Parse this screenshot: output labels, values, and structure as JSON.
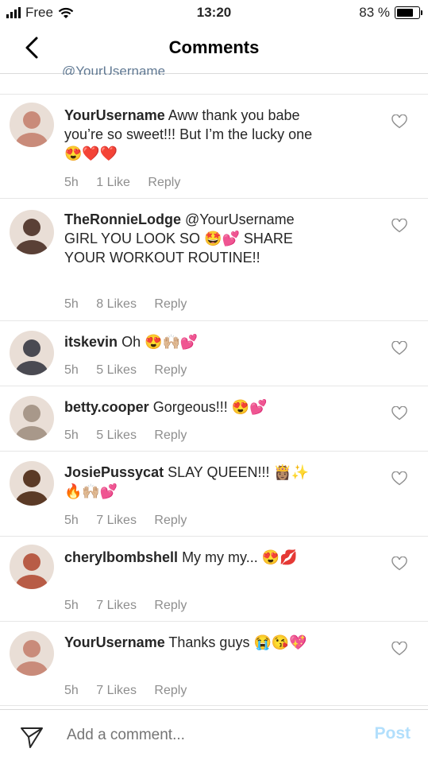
{
  "status": {
    "carrier": "Free",
    "time": "13:20",
    "battery": "83 %",
    "battery_level": 0.83
  },
  "nav": {
    "title": "Comments"
  },
  "clipped_mention": "@YourUsername",
  "comments": [
    {
      "user": "YourUsername",
      "text": "Aww thank you babe you’re so sweet!!! But I’m the lucky one 😍❤️❤️",
      "time": "5h",
      "likes": "1 Like",
      "reply": "Reply",
      "avatar_color": "#c98b7a"
    },
    {
      "user": "TheRonnieLodge",
      "text": "@YourUsername GIRL YOU LOOK SO 🤩💕 SHARE YOUR WORKOUT ROUTINE!!",
      "time": "5h",
      "likes": "8 Likes",
      "reply": "Reply",
      "avatar_color": "#5a4036"
    },
    {
      "user": "itskevin",
      "text": "Oh 😍🙌🏼💕",
      "time": "5h",
      "likes": "5 Likes",
      "reply": "Reply",
      "avatar_color": "#4a4a52"
    },
    {
      "user": "betty.cooper",
      "text": "Gorgeous!!! 😍💕",
      "time": "5h",
      "likes": "5 Likes",
      "reply": "Reply",
      "avatar_color": "#a8988a"
    },
    {
      "user": "JosiePussycat",
      "text": "SLAY QUEEN!!! 👸🏽✨🔥🙌🏼💕",
      "time": "5h",
      "likes": "7 Likes",
      "reply": "Reply",
      "avatar_color": "#5b3a26"
    },
    {
      "user": "cherylbombshell",
      "text": "My my my... 😍💋",
      "time": "5h",
      "likes": "7 Likes",
      "reply": "Reply",
      "avatar_color": "#b85c46"
    },
    {
      "user": "YourUsername",
      "text": "Thanks guys 😭😘💖",
      "time": "5h",
      "likes": "7 Likes",
      "reply": "Reply",
      "avatar_color": "#c98b7a"
    }
  ],
  "composer": {
    "placeholder": "Add a comment...",
    "post_label": "Post"
  }
}
